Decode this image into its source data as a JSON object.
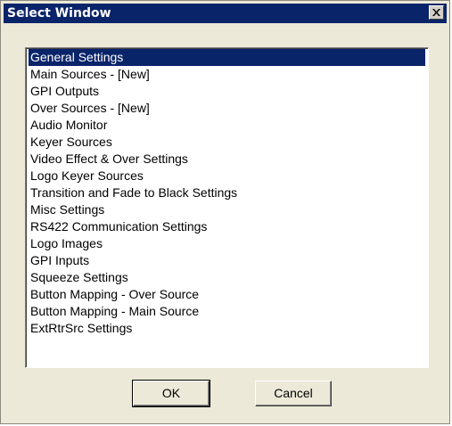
{
  "window": {
    "title": "Select Window",
    "close_glyph": "close-icon"
  },
  "list": {
    "selected_index": 0,
    "items": [
      "General Settings",
      "Main Sources - [New]",
      "GPI Outputs",
      "Over Sources - [New]",
      "Audio Monitor",
      "Keyer Sources",
      "Video Effect & Over Settings",
      "Logo Keyer Sources",
      "Transition and Fade to Black Settings",
      "Misc Settings",
      "RS422 Communication Settings",
      "Logo Images",
      "GPI Inputs",
      "Squeeze Settings",
      "Button Mapping - Over Source",
      "Button Mapping - Main Source",
      "ExtRtrSrc Settings"
    ]
  },
  "buttons": {
    "ok_label": "OK",
    "cancel_label": "Cancel"
  },
  "colors": {
    "titlebar": "#0a246a",
    "selection": "#0a246a",
    "dialog_bg": "#ece9d8"
  }
}
